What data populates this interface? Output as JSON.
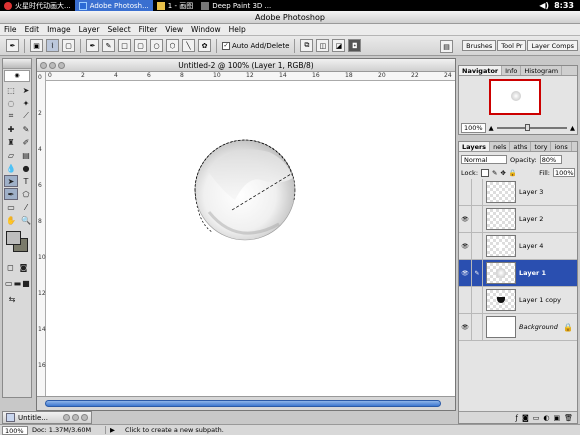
{
  "taskbar": {
    "items": [
      {
        "label": "火星时代动画大..."
      },
      {
        "label": "Adobe Photosh..."
      },
      {
        "label": "1 - 画图"
      },
      {
        "label": "Deep Paint 3D ..."
      }
    ],
    "clock": "8:33"
  },
  "app": {
    "title": "Adobe Photoshop"
  },
  "menu": [
    "File",
    "Edit",
    "Image",
    "Layer",
    "Select",
    "Filter",
    "View",
    "Window",
    "Help"
  ],
  "options": {
    "auto_add_label": "Auto Add/Delete"
  },
  "palette_well": [
    "Brushes",
    "Tool Pr",
    "Layer Comps"
  ],
  "document": {
    "title": "Untitled-2 @ 100% (Layer 1, RGB/8)",
    "ruler_marks": [
      "0",
      "2",
      "4",
      "6",
      "8",
      "10",
      "12",
      "14",
      "16",
      "18",
      "20",
      "22",
      "24"
    ],
    "ruler_left_marks": [
      "0",
      "2",
      "4",
      "6",
      "8",
      "10",
      "12",
      "14",
      "16"
    ]
  },
  "navigator": {
    "tabs": [
      "Navigator",
      "Info",
      "Histogram"
    ],
    "zoom": "100%"
  },
  "layers": {
    "tabs": [
      "Layers",
      "nels",
      "aths",
      "tory",
      "ions"
    ],
    "blend_mode": "Normal",
    "opacity_label": "Opacity:",
    "opacity": "80%",
    "lock_label": "Lock:",
    "fill_label": "Fill:",
    "fill": "100%",
    "items": [
      {
        "name": "Layer 3",
        "visible": false
      },
      {
        "name": "Layer 2",
        "visible": true
      },
      {
        "name": "Layer 4",
        "visible": true
      },
      {
        "name": "Layer 1",
        "visible": true,
        "selected": true
      },
      {
        "name": "Layer 1 copy",
        "visible": false
      },
      {
        "name": "Background",
        "visible": true
      }
    ]
  },
  "minidoc": {
    "label": "Untitle..."
  },
  "status": {
    "zoom": "100%",
    "doc": "Doc: 1.37M/3.60M",
    "hint": "Click to create a new subpath."
  },
  "colors": {
    "accent": "#2a4fb0",
    "taskbar": "#000000"
  }
}
